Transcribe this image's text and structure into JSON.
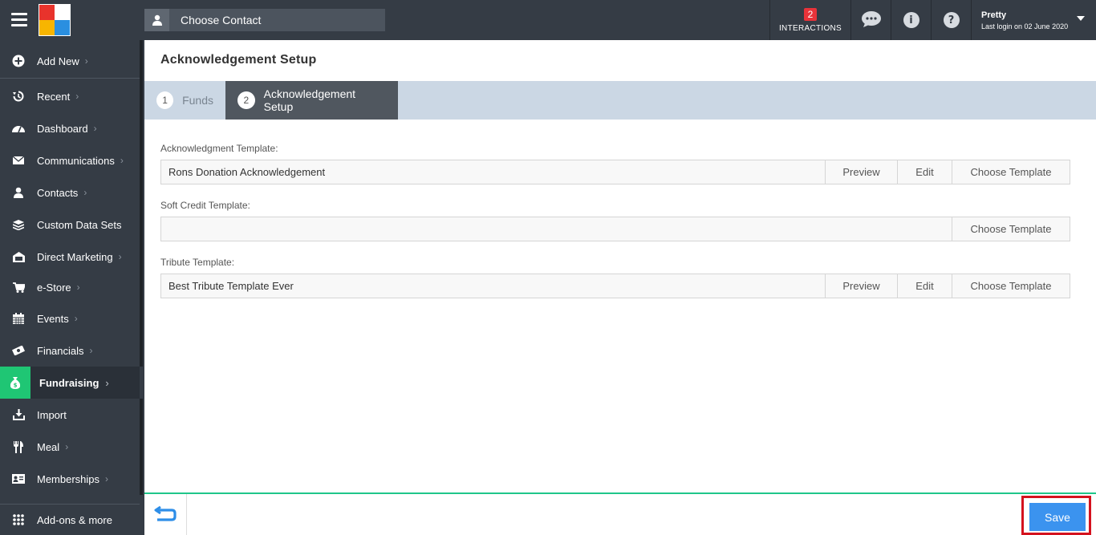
{
  "topbar": {
    "contact_placeholder": "Choose Contact",
    "interactions_count": "2",
    "interactions_label": "INTERACTIONS",
    "user_name": "Pretty",
    "last_login": "Last login on 02 June 2020",
    "icons": [
      "chat-icon",
      "info-icon",
      "help-icon"
    ]
  },
  "sidebar": {
    "add_new": "Add New",
    "items": [
      {
        "label": "Recent",
        "icon": "history-icon"
      },
      {
        "label": "Dashboard",
        "icon": "dashboard-icon"
      },
      {
        "label": "Communications",
        "icon": "envelope-icon"
      },
      {
        "label": "Contacts",
        "icon": "user-icon"
      },
      {
        "label": "Custom Data Sets",
        "icon": "layers-icon"
      },
      {
        "label": "Direct Marketing",
        "icon": "mailbox-icon"
      },
      {
        "label": "e-Store",
        "icon": "cart-icon"
      },
      {
        "label": "Events",
        "icon": "calendar-icon"
      },
      {
        "label": "Financials",
        "icon": "money-icon"
      },
      {
        "label": "Fundraising",
        "icon": "money-bag-icon"
      },
      {
        "label": "Import",
        "icon": "import-icon"
      },
      {
        "label": "Meal",
        "icon": "cutlery-icon"
      },
      {
        "label": "Memberships",
        "icon": "id-card-icon"
      }
    ],
    "addons": "Add-ons & more"
  },
  "main": {
    "title": "Acknowledgement Setup",
    "steps": [
      {
        "num": "1",
        "label": "Funds"
      },
      {
        "num": "2",
        "label": "Acknowledgement Setup"
      }
    ],
    "fields": {
      "ack": {
        "label": "Acknowledgment Template:",
        "value": "Rons Donation Acknowledgement"
      },
      "soft": {
        "label": "Soft Credit Template:",
        "value": ""
      },
      "tribute": {
        "label": "Tribute Template:",
        "value": "Best Tribute Template Ever"
      }
    },
    "buttons": {
      "preview": "Preview",
      "edit": "Edit",
      "choose": "Choose Template"
    }
  },
  "footer": {
    "save": "Save"
  },
  "colors": {
    "topbar": "#353c45",
    "accent_green": "#1fc674",
    "save_blue": "#3b93ef",
    "highlight_red": "#d4121e",
    "badge_red": "#e8333a"
  }
}
